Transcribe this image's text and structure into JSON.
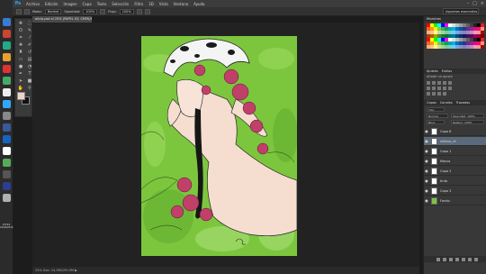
{
  "app": {
    "logo": "Ps"
  },
  "menubar": {
    "items": [
      "Archivo",
      "Edición",
      "Imagen",
      "Capa",
      "Texto",
      "Selección",
      "Filtro",
      "3D",
      "Vista",
      "Ventana",
      "Ayuda"
    ]
  },
  "window_controls": {
    "minimize": "–",
    "maximize": "□",
    "close": "×"
  },
  "options": {
    "mode_label": "Modo:",
    "mode_value": "Normal",
    "opacity_label": "Opacidad:",
    "opacity_value": "100%",
    "flow_label": "Flujo:",
    "flow_value": "100%",
    "workspace": "Aspectos esenciales"
  },
  "document": {
    "tab_title": "alicia.psd al 25% (PAPEL 03, CMYK/8) ×",
    "status": "25%  Doc: 24,9M/199,9M  ▶"
  },
  "colors": {
    "foreground": "#f0d4c4",
    "background": "#111111",
    "accent": "#31a8ff"
  },
  "panels": {
    "swatches_tabs": [
      "Muestras"
    ],
    "adjust_tabs": [
      "Ajustes",
      "Estilos"
    ],
    "adjust_label": "Añadir un ajuste",
    "layers_tabs": [
      "Capas",
      "Canales",
      "Trazados"
    ],
    "kind_filter": "Tipo",
    "blend_mode": "Normal",
    "opacity_label": "Opacidad: 100%",
    "lock_label": "Bloq:",
    "fill_label": "Relleno: 100%"
  },
  "layers": [
    {
      "name": "Capa 6",
      "active": false
    },
    {
      "name": "relleno_ch",
      "active": true
    },
    {
      "name": "Capa 1",
      "active": false
    },
    {
      "name": "Manos",
      "active": false
    },
    {
      "name": "Capa 2",
      "active": false
    },
    {
      "name": "tinta",
      "active": false
    },
    {
      "name": "Capa 3",
      "active": false
    },
    {
      "name": "Fondo",
      "active": false
    }
  ],
  "taskbar": {
    "clock_time": "18:44",
    "clock_date": "22/04/2016"
  },
  "tools": [
    "move",
    "marquee",
    "lasso",
    "quick-select",
    "crop",
    "eyedropper",
    "healing",
    "brush",
    "stamp",
    "history-brush",
    "eraser",
    "gradient",
    "blur",
    "dodge",
    "pen",
    "type",
    "path-select",
    "shape",
    "hand",
    "zoom"
  ]
}
